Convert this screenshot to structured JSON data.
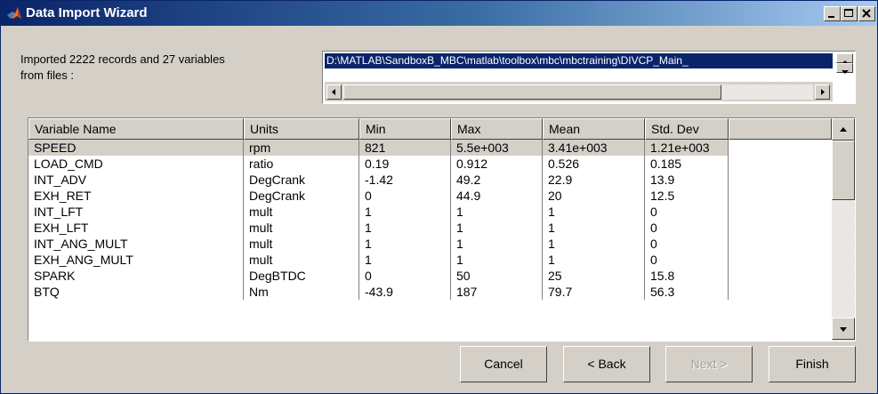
{
  "window": {
    "title": "Data Import Wizard"
  },
  "info": {
    "line1": "Imported 2222 records and 27 variables",
    "line2": "from files :"
  },
  "file_list": {
    "selected_path": "D:\\MATLAB\\SandboxB_MBC\\matlab\\toolbox\\mbc\\mbctraining\\DIVCP_Main_"
  },
  "table": {
    "columns": [
      "Variable Name",
      "Units",
      "Min",
      "Max",
      "Mean",
      "Std. Dev"
    ],
    "rows": [
      [
        "SPEED",
        "rpm",
        "821",
        "5.5e+003",
        "3.41e+003",
        "1.21e+003"
      ],
      [
        "LOAD_CMD",
        "ratio",
        "0.19",
        "0.912",
        "0.526",
        "0.185"
      ],
      [
        "INT_ADV",
        "DegCrank",
        "-1.42",
        "49.2",
        "22.9",
        "13.9"
      ],
      [
        "EXH_RET",
        "DegCrank",
        "0",
        "44.9",
        "20",
        "12.5"
      ],
      [
        "INT_LFT",
        "mult",
        "1",
        "1",
        "1",
        "0"
      ],
      [
        "EXH_LFT",
        "mult",
        "1",
        "1",
        "1",
        "0"
      ],
      [
        "INT_ANG_MULT",
        "mult",
        "1",
        "1",
        "1",
        "0"
      ],
      [
        "EXH_ANG_MULT",
        "mult",
        "1",
        "1",
        "1",
        "0"
      ],
      [
        "SPARK",
        "DegBTDC",
        "0",
        "50",
        "25",
        "15.8"
      ],
      [
        "BTQ",
        "Nm",
        "-43.9",
        "187",
        "79.7",
        "56.3"
      ]
    ],
    "selected_row": 0
  },
  "buttons": {
    "cancel": "Cancel",
    "back": "< Back",
    "next": "Next >",
    "finish": "Finish"
  }
}
